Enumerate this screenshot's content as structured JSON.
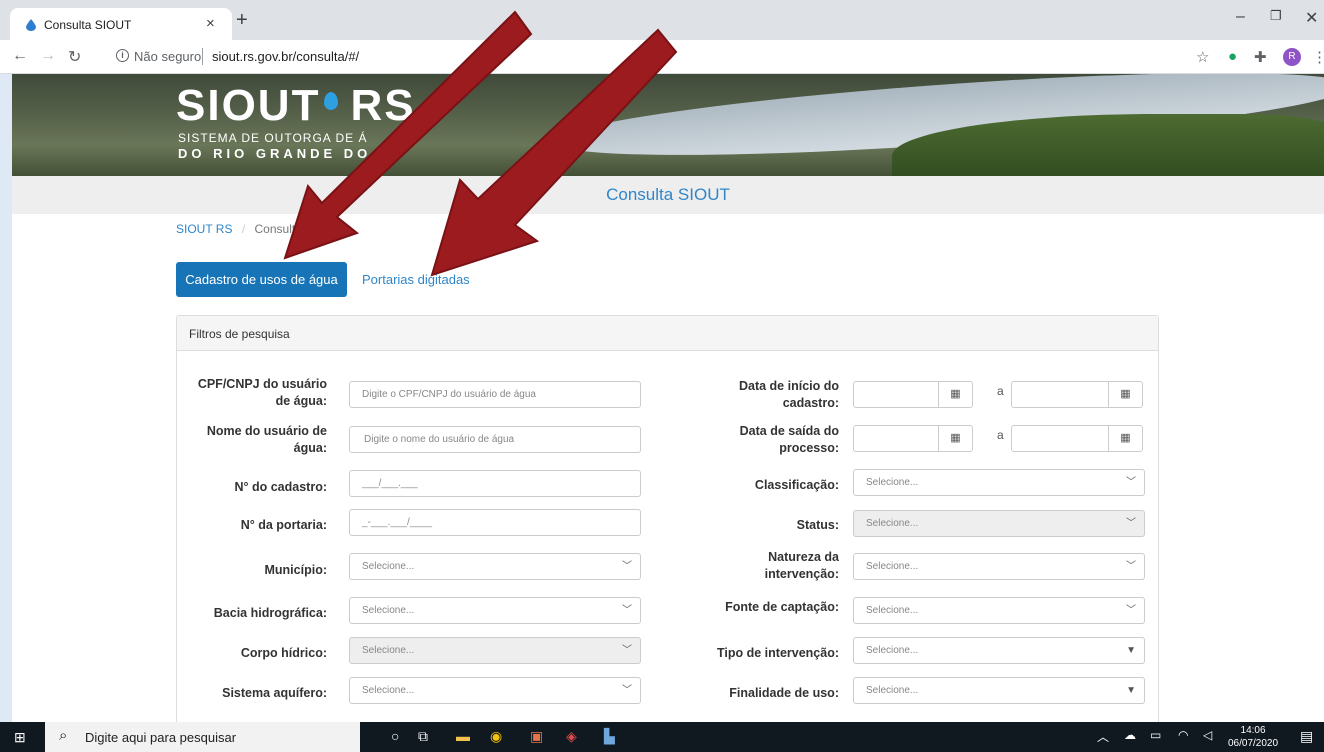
{
  "browser": {
    "tab_title": "Consulta SIOUT",
    "tab_close": "×",
    "new_tab": "+",
    "security": "Não seguro",
    "url": "siout.rs.gov.br/consulta/#/",
    "profile_initial": "R"
  },
  "banner": {
    "logo_main": "SIOUT",
    "logo_rs": "RS",
    "line1": "SISTEMA DE OUTORGA DE Á",
    "line2": "DO RIO GRANDE DO"
  },
  "page_title": "Consulta SIOUT",
  "breadcrumb": {
    "home": "SIOUT RS",
    "separator": "/",
    "current": "Consult"
  },
  "tabs": {
    "active": "Cadastro de usos de água",
    "other": "Portarias digitadas"
  },
  "panel_title": "Filtros de pesquisa",
  "filters_left": {
    "cpf_label_1": "CPF/CNPJ do usuário",
    "cpf_label_2": "de água:",
    "cpf_placeholder": "Digite o CPF/CNPJ do usuário de água",
    "nome_label_1": "Nome do usuário de",
    "nome_label_2": "água:",
    "nome_placeholder": "Digite o nome do usuário de água",
    "cadastro_label": "N° do cadastro:",
    "cadastro_mask": "___/___.___",
    "portaria_label": "N° da portaria:",
    "portaria_mask": "_-___.___/____",
    "municipio_label": "Município:",
    "bacia_label": "Bacia hidrográfica:",
    "corpo_label": "Corpo hídrico:",
    "aquifero_label": "Sistema aquífero:",
    "select_placeholder": "Selecione..."
  },
  "filters_right": {
    "inicio_label_1": "Data de início do",
    "inicio_label_2": "cadastro:",
    "saida_label_1": "Data de saída do",
    "saida_label_2": "processo:",
    "range_sep": "a",
    "classificacao_label": "Classificação:",
    "status_label": "Status:",
    "natureza_label_1": "Natureza da",
    "natureza_label_2": "intervenção:",
    "fonte_label": "Fonte de captação:",
    "tipo_label": "Tipo de intervenção:",
    "finalidade_label": "Finalidade de uso:",
    "select_placeholder": "Selecione..."
  },
  "taskbar": {
    "search_placeholder": "Digite aqui para pesquisar",
    "time": "14:06",
    "date": "06/07/2020"
  },
  "colors": {
    "primary": "#1775b7",
    "link": "#2f86c9",
    "arrow": "#9b1b1f"
  }
}
